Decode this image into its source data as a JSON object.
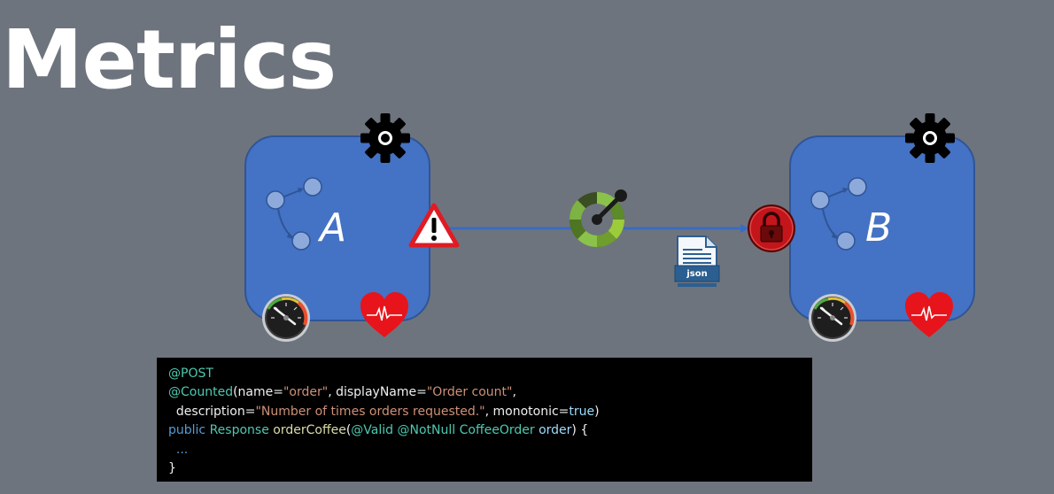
{
  "title": "Metrics",
  "services": [
    {
      "letter": "A"
    },
    {
      "letter": "B"
    }
  ],
  "payload_label": "json",
  "colors": {
    "background": "#6e747d",
    "service_fill": "#4472c4",
    "connector": "#3a6bc2",
    "heart": "#e8141b",
    "warning": "#e01b24"
  },
  "icons": [
    "gear-icon",
    "flow-nodes-icon",
    "gauge-icon",
    "heart-pulse-icon",
    "warning-icon",
    "circuit-breaker-icon",
    "lock-icon",
    "json-document-icon"
  ],
  "code": {
    "line1": {
      "ann": "@POST"
    },
    "line2": {
      "ann": "@Counted",
      "p1": "(name=",
      "s1": "\"order\"",
      "p2": ", displayName=",
      "s2": "\"Order count\"",
      "p3": ","
    },
    "line3": {
      "p1": "  description=",
      "s1": "\"Number of times orders requested.\"",
      "p2": ", monotonic=",
      "lit": "true",
      "p3": ")"
    },
    "line4": {
      "kw": "public",
      "sp1": " ",
      "type": "Response",
      "sp2": " ",
      "fn": "orderCoffee",
      "p1": "(",
      "ann1": "@Valid",
      "sp3": " ",
      "ann2": "@NotNull",
      "sp4": " ",
      "type2": "CoffeeOrder",
      "sp5": " ",
      "param": "order",
      "p2": ") {"
    },
    "line5": {
      "ell": "  ..."
    },
    "line6": {
      "p1": "}"
    }
  }
}
